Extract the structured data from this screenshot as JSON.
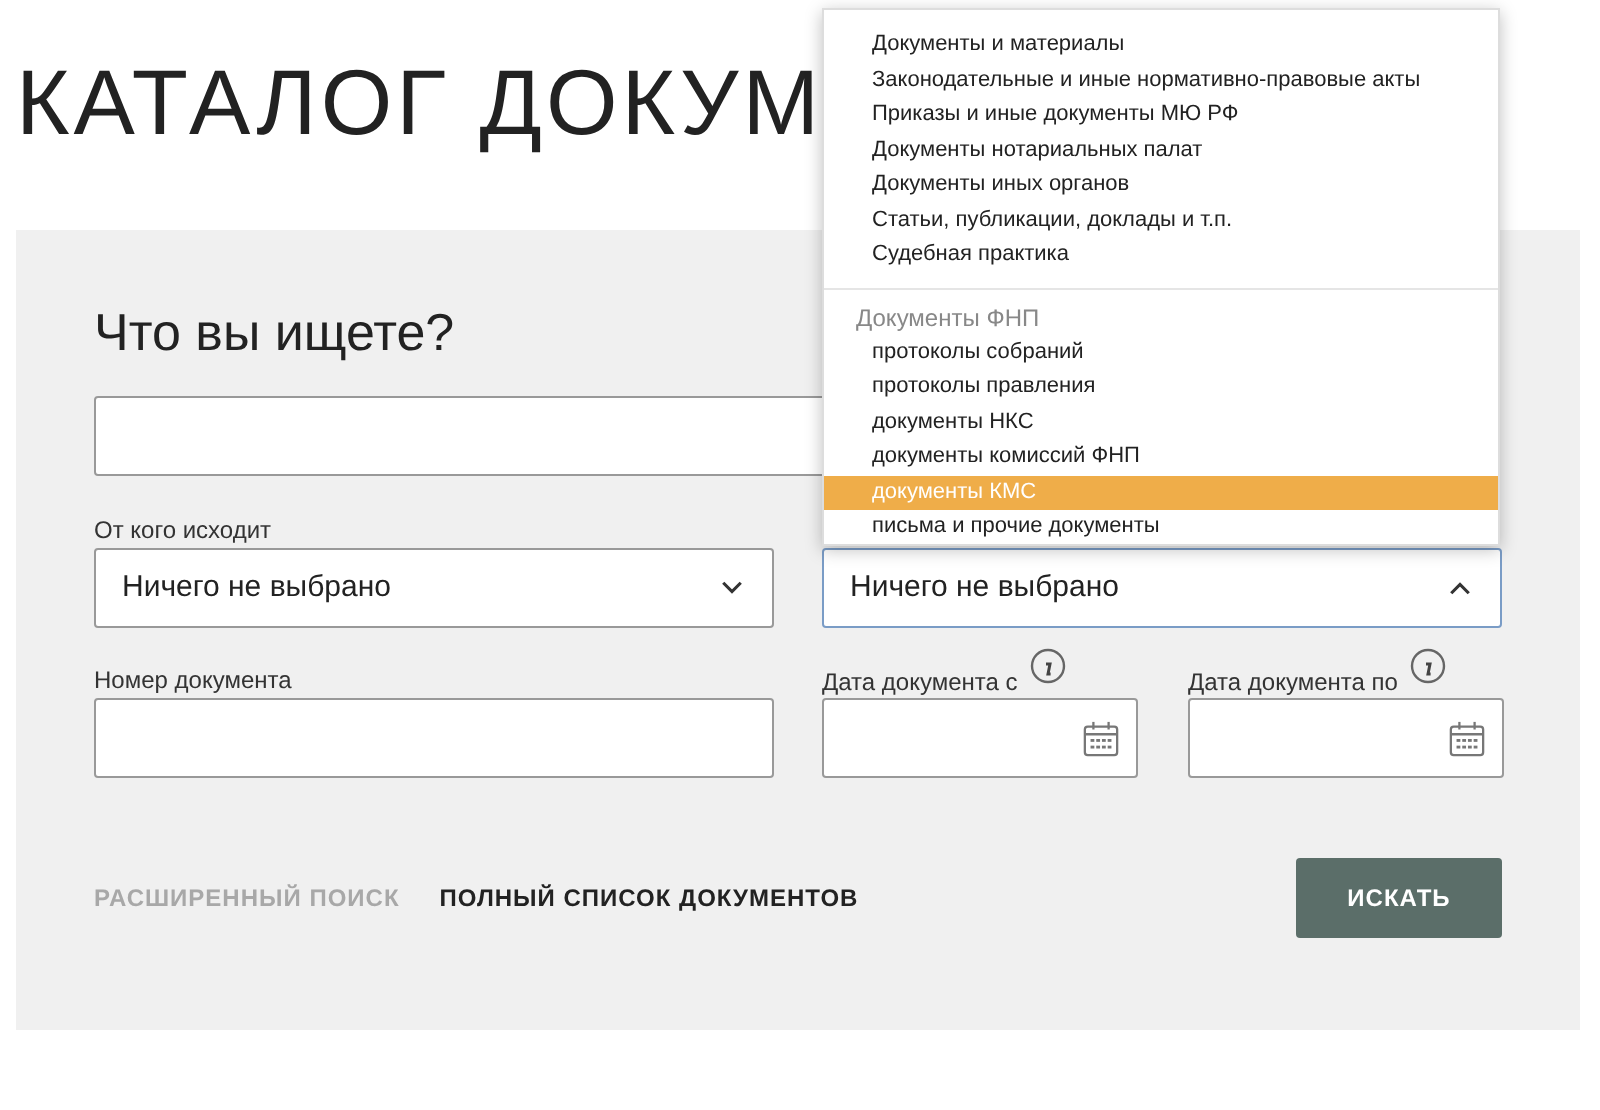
{
  "page_title": "КАТАЛОГ ДОКУМ",
  "form": {
    "heading": "Что вы ищете?",
    "source_select": {
      "label": "От кого исходит",
      "value": "Ничего не выбрано",
      "expanded": false
    },
    "type_select": {
      "value": "Ничего не выбрано",
      "expanded": true
    },
    "number_field": {
      "label": "Номер документа"
    },
    "date_from": {
      "label": "Дата документа с"
    },
    "date_to": {
      "label": "Дата документа по"
    },
    "advanced_link": {
      "label": "РАСШИРЕННЫЙ ПОИСК",
      "disabled": true
    },
    "full_list_link": {
      "label": "ПОЛНЫЙ СПИСОК ДОКУМЕНТОВ",
      "disabled": false
    },
    "search_button": "ИСКАТЬ"
  },
  "dropdown": {
    "groups": [
      {
        "items": [
          {
            "label": "Документы и материалы",
            "selected": false
          },
          {
            "label": "Законодательные и иные нормативно-правовые акты",
            "selected": false
          },
          {
            "label": "Приказы и иные документы МЮ РФ",
            "selected": false
          },
          {
            "label": "Документы нотариальных палат",
            "selected": false
          },
          {
            "label": "Документы иных органов",
            "selected": false
          },
          {
            "label": "Статьи, публикации, доклады и т.п.",
            "selected": false
          },
          {
            "label": "Судебная практика",
            "selected": false
          }
        ]
      },
      {
        "header": "Документы ФНП",
        "items": [
          {
            "label": "протоколы собраний",
            "selected": false
          },
          {
            "label": "протоколы правления",
            "selected": false
          },
          {
            "label": "документы НКС",
            "selected": false
          },
          {
            "label": "документы комиссий ФНП",
            "selected": false
          },
          {
            "label": "документы КМС",
            "selected": true
          },
          {
            "label": "письма и прочие документы",
            "selected": false
          }
        ]
      }
    ]
  }
}
